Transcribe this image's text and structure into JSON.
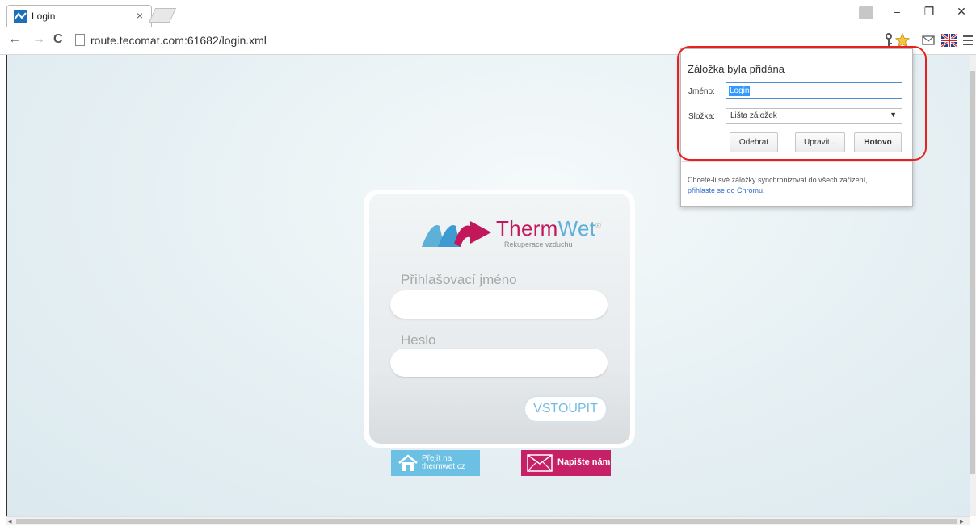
{
  "browser": {
    "tab_title": "Login",
    "tab_close": "×",
    "url": "route.tecomat.com:61682/login.xml",
    "window_controls": {
      "minimize": "–",
      "restore": "❐",
      "close": "✕"
    },
    "nav": {
      "back": "←",
      "forward": "→",
      "reload": "C"
    },
    "toolbar_icons": [
      "key-icon",
      "star-icon",
      "extension-icon",
      "flag-icon",
      "menu-icon"
    ]
  },
  "login": {
    "brand_therm": "Therm",
    "brand_wet": "Wet",
    "brand_reg": "®",
    "brand_subtitle": "Rekuperace vzduchu",
    "username_label": "Přihlašovací jméno",
    "password_label": "Heslo",
    "submit_label": "VSTOUPIT",
    "link_web_line1": "Přejít na",
    "link_web_line2": "thermwet.cz",
    "link_mail": "Napište nám"
  },
  "bookmark_bubble": {
    "title": "Záložka byla přidána",
    "name_label": "Jméno:",
    "name_value": "Login",
    "folder_label": "Složka:",
    "folder_value": "Lišta záložek",
    "remove_button": "Odebrat",
    "edit_button": "Upravit...",
    "done_button": "Hotovo",
    "sync_text": "Chcete-li své záložky synchronizovat do všech zařízení,",
    "sync_link": "přihlaste se do Chromu",
    "sync_end": "."
  },
  "colors": {
    "brand_magenta": "#c2185b",
    "brand_blue": "#5fb0d8",
    "highlight_red": "#e8201f"
  }
}
